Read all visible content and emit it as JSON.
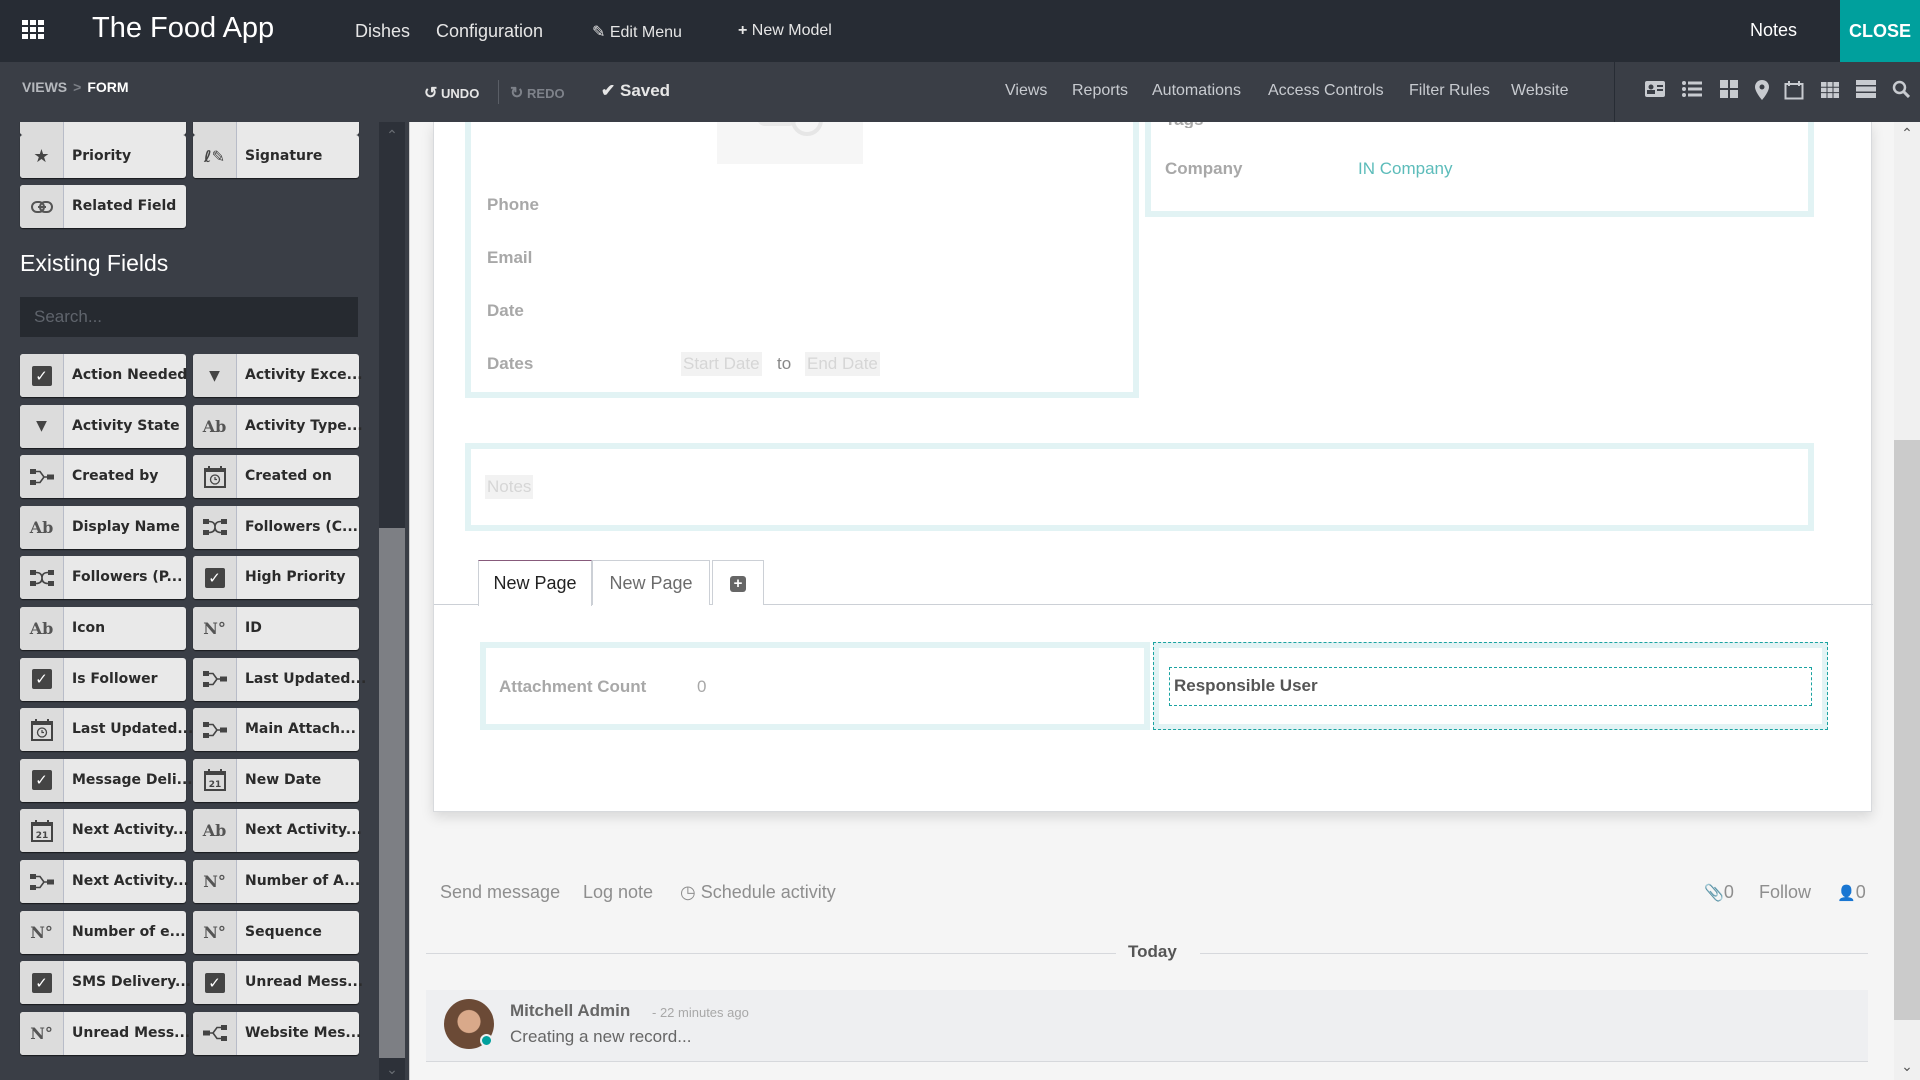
{
  "topbar": {
    "app_title": "The Food App",
    "menus": [
      "Dishes",
      "Configuration"
    ],
    "edit_menu": "Edit Menu",
    "new_model": "New Model",
    "notes": "Notes",
    "close": "CLOSE",
    "accent_color": "#00a09d"
  },
  "subbar": {
    "breadcrumb": [
      "VIEWS",
      "FORM"
    ],
    "breadcrumb_sep": ">",
    "undo": "UNDO",
    "redo": "REDO",
    "saved": "Saved",
    "menus": [
      "Views",
      "Reports",
      "Automations",
      "Access Controls",
      "Filter Rules",
      "Website"
    ],
    "view_icons": [
      "form-view-icon",
      "list-view-icon",
      "kanban-view-icon",
      "map-view-icon",
      "calendar-view-icon",
      "pivot-view-icon",
      "graph-view-icon",
      "search-view-icon"
    ]
  },
  "sidebar": {
    "new_fields": [
      {
        "label": "Priority",
        "icon": "star-icon"
      },
      {
        "label": "Signature",
        "icon": "signature-icon"
      },
      {
        "label": "Related Field",
        "icon": "link-icon"
      }
    ],
    "existing_title": "Existing Fields",
    "search_placeholder": "Search...",
    "existing_fields": [
      {
        "label": "Action Needed",
        "icon": "checkbox"
      },
      {
        "label": "Activity Exce...",
        "icon": "selection"
      },
      {
        "label": "Activity State",
        "icon": "selection"
      },
      {
        "label": "Activity Type...",
        "icon": "char"
      },
      {
        "label": "Created by",
        "icon": "many2one"
      },
      {
        "label": "Created on",
        "icon": "datetime"
      },
      {
        "label": "Display Name",
        "icon": "char"
      },
      {
        "label": "Followers (C...",
        "icon": "many2many"
      },
      {
        "label": "Followers (P...",
        "icon": "many2many"
      },
      {
        "label": "High Priority",
        "icon": "checkbox"
      },
      {
        "label": "Icon",
        "icon": "char"
      },
      {
        "label": "ID",
        "icon": "integer"
      },
      {
        "label": "Is Follower",
        "icon": "checkbox"
      },
      {
        "label": "Last Updated...",
        "icon": "many2one"
      },
      {
        "label": "Last Updated...",
        "icon": "datetime"
      },
      {
        "label": "Main Attach...",
        "icon": "many2one"
      },
      {
        "label": "Message Deli...",
        "icon": "checkbox"
      },
      {
        "label": "New Date",
        "icon": "date"
      },
      {
        "label": "Next Activity...",
        "icon": "date"
      },
      {
        "label": "Next Activity...",
        "icon": "char"
      },
      {
        "label": "Next Activity...",
        "icon": "many2one"
      },
      {
        "label": "Number of A...",
        "icon": "integer"
      },
      {
        "label": "Number of e...",
        "icon": "integer"
      },
      {
        "label": "Sequence",
        "icon": "integer"
      },
      {
        "label": "SMS Delivery...",
        "icon": "checkbox"
      },
      {
        "label": "Unread Mess...",
        "icon": "checkbox"
      },
      {
        "label": "Unread Mess...",
        "icon": "integer"
      },
      {
        "label": "Website Mes...",
        "icon": "one2many"
      }
    ]
  },
  "form": {
    "left_fields": [
      {
        "label": "Phone",
        "value": ""
      },
      {
        "label": "Email",
        "value": ""
      },
      {
        "label": "Date",
        "value": ""
      },
      {
        "label": "Dates",
        "value": ""
      }
    ],
    "start_date_placeholder": "Start Date",
    "date_range_sep": "to",
    "end_date_placeholder": "End Date",
    "company_label": "Company",
    "company_value": "IN Company",
    "notes_placeholder": "Notes",
    "tabs": [
      {
        "label": "New Page",
        "active": true
      },
      {
        "label": "New Page",
        "active": false
      }
    ],
    "attachment_count_label": "Attachment Count",
    "attachment_count_value": "0",
    "responsible_user_label": "Responsible User"
  },
  "chatter": {
    "send_message": "Send message",
    "log_note": "Log note",
    "schedule_activity": "Schedule activity",
    "attachments_count": "0",
    "follow": "Follow",
    "followers_count": "0",
    "date_separator": "Today",
    "messages": [
      {
        "author": "Mitchell Admin",
        "time": "- 22 minutes ago",
        "body": "Creating a new record..."
      }
    ]
  }
}
